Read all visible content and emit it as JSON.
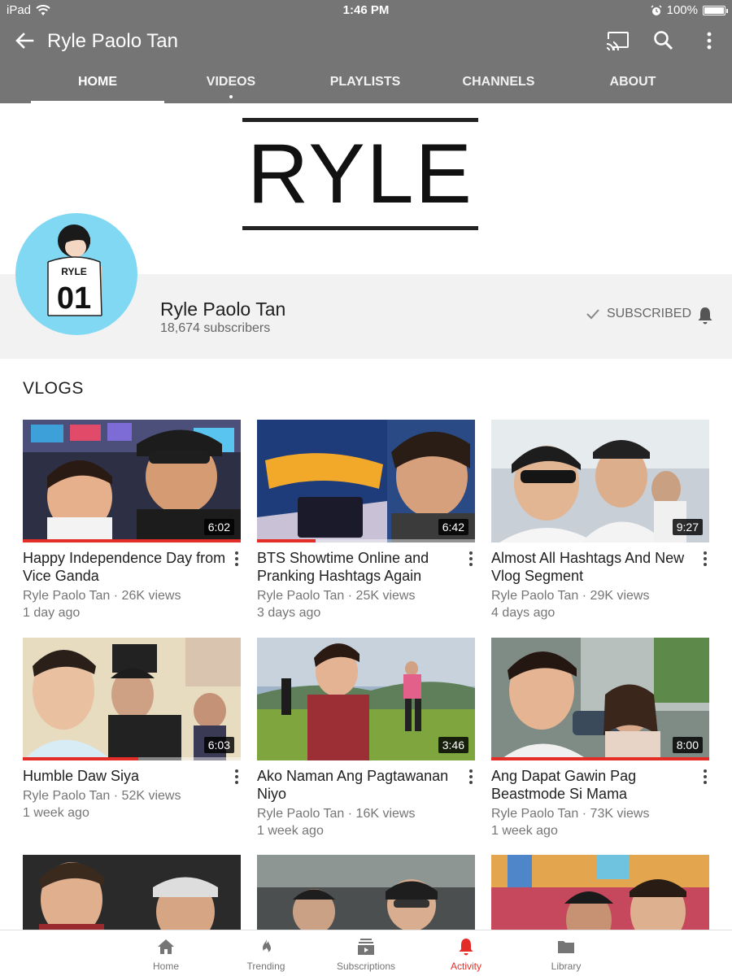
{
  "status_bar": {
    "device": "iPad",
    "time": "1:46 PM",
    "battery": "100%",
    "battery_level": 1.0
  },
  "app_bar": {
    "title": "Ryle Paolo Tan"
  },
  "tabs": [
    {
      "label": "HOME"
    },
    {
      "label": "VIDEOS"
    },
    {
      "label": "PLAYLISTS"
    },
    {
      "label": "CHANNELS"
    },
    {
      "label": "ABOUT"
    }
  ],
  "banner": {
    "logo_text": "RYLE"
  },
  "avatar": {
    "jersey_name": "RYLE",
    "jersey_number": "01"
  },
  "channel": {
    "name": "Ryle Paolo Tan",
    "subscribers": "18,674 subscribers",
    "subscribe_label": "SUBSCRIBED"
  },
  "section": {
    "title": "VLOGS"
  },
  "videos": [
    {
      "title": "Happy Independence Day from Vice Ganda",
      "channel": "Ryle Paolo Tan",
      "views": "26K views",
      "age": "1 day ago",
      "duration": "6:02",
      "progress": 1.0
    },
    {
      "title": "BTS Showtime Online and Pranking Hashtags Again",
      "channel": "Ryle Paolo Tan",
      "views": "25K views",
      "age": "3 days ago",
      "duration": "6:42",
      "progress": 0.27
    },
    {
      "title": "Almost All Hashtags And New Vlog Segment",
      "channel": "Ryle Paolo Tan",
      "views": "29K views",
      "age": "4 days ago",
      "duration": "9:27",
      "progress": 0
    },
    {
      "title": "Humble Daw Siya",
      "channel": "Ryle Paolo Tan",
      "views": "52K views",
      "age": "1 week ago",
      "duration": "6:03",
      "progress": 0.53
    },
    {
      "title": "Ako Naman Ang Pagtawanan Niyo",
      "channel": "Ryle Paolo Tan",
      "views": "16K views",
      "age": "1 week ago",
      "duration": "3:46",
      "progress": 0
    },
    {
      "title": "Ang Dapat Gawin Pag Beastmode Si Mama",
      "channel": "Ryle Paolo Tan",
      "views": "73K views",
      "age": "1 week ago",
      "duration": "8:00",
      "progress": 1.0
    }
  ],
  "bottom_nav": [
    {
      "label": "Home",
      "icon": "home-icon"
    },
    {
      "label": "Trending",
      "icon": "trending-icon"
    },
    {
      "label": "Subscriptions",
      "icon": "subscriptions-icon"
    },
    {
      "label": "Activity",
      "icon": "activity-icon"
    },
    {
      "label": "Library",
      "icon": "library-icon"
    }
  ],
  "colors": {
    "app_bar": "#757575",
    "accent_red": "#e52d27",
    "avatar_bg": "#81d8f3",
    "header_bg": "#f2f2f2"
  }
}
